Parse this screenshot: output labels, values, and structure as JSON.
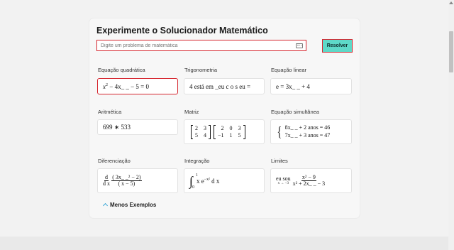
{
  "panel": {
    "title": "Experimente o Solucionador Matemático",
    "search_placeholder": "Digite um problema de matemática",
    "solve_label": "Resolver",
    "less_examples_label": "Menos Exemplos"
  },
  "examples": {
    "quadratic": {
      "label": "Equação quadrática",
      "expr": "x^2 − 4x_ _ − 5 = 0"
    },
    "trig": {
      "label": "Trigonometria",
      "expr": "4 está em _eu c o s eu ="
    },
    "linear": {
      "label": "Equação linear",
      "expr": "e = 3x_ _ + 4"
    },
    "arith": {
      "label": "Aritmética",
      "expr": "699 ∗ 533"
    },
    "matrix": {
      "label": "Matriz",
      "left": [
        "2",
        "3",
        "5",
        "4"
      ],
      "right": [
        "2",
        "0",
        "3",
        "−1",
        "1",
        "5"
      ]
    },
    "simul": {
      "label": "Equação simultânea",
      "line1": "8x_ _ + 2 anos = 46",
      "line2": "7x_ _ + 3 anos = 47"
    },
    "diff": {
      "label": "Diferenciação",
      "d_num": "d",
      "d_den": "d x",
      "num": "( 3x_ _² − 2)",
      "den": "( x − 5)"
    },
    "integ": {
      "label": "Integração",
      "upper": "1",
      "lower": "0",
      "body": "x e",
      "exp": "−x²",
      "tail": "d x"
    },
    "limit": {
      "label": "Limites",
      "lim": "eu sou",
      "sub": "x → −3",
      "num": "x² − 9",
      "den": "x² + 2x_ _ − 3"
    }
  }
}
